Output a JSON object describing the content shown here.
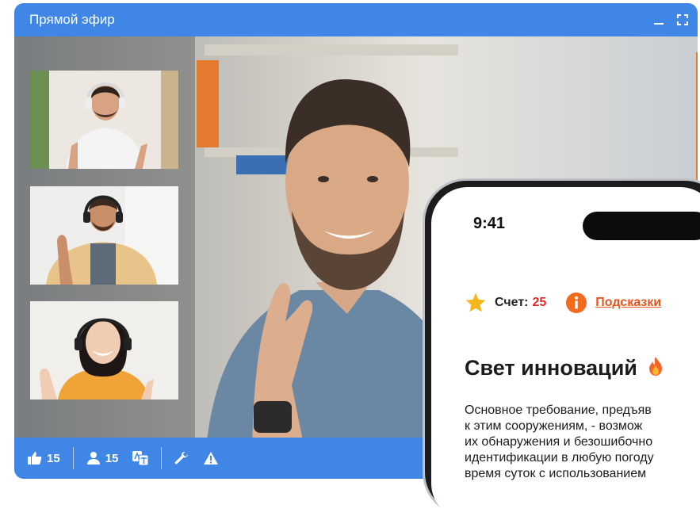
{
  "window": {
    "title": "Прямой эфир",
    "accent": "#3f86e6"
  },
  "footer": {
    "likes": "15",
    "participants": "15"
  },
  "phone": {
    "time": "9:41",
    "score_label": "Счет:",
    "score_value": "25",
    "hints_label": "Подсказки",
    "card_title": "Свет инноваций",
    "card_body": [
      "Основное требование, предъяв",
      "к этим сооружениям, - возмож",
      "их обнаружения и безошибочно",
      "идентификации в любую погоду",
      "время суток с использованием"
    ]
  }
}
